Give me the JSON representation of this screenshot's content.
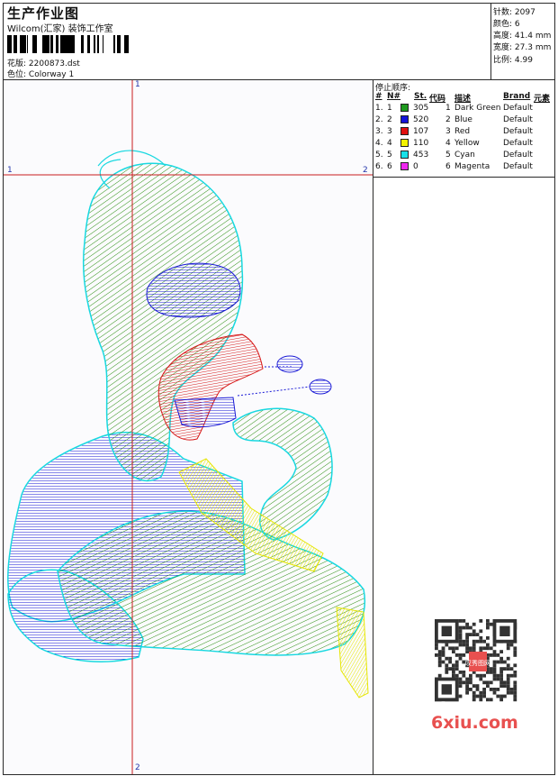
{
  "header": {
    "title": "生产作业图",
    "company": "Wilcom(汇家) 装饰工作室",
    "design_label": "花版:",
    "design_file": "2200873.dst",
    "colorway_label": "色位:",
    "colorway": "Colorway 1"
  },
  "stats": [
    {
      "label": "针数:",
      "value": "2097"
    },
    {
      "label": "颜色:",
      "value": "6"
    },
    {
      "label": "高度:",
      "value": "41.4 mm"
    },
    {
      "label": "宽度:",
      "value": "27.3 mm"
    },
    {
      "label": "比例:",
      "value": "4.99"
    }
  ],
  "legend": {
    "title": "停止顺序:",
    "headers": {
      "hash": "#",
      "no": "N#",
      "st": "St.",
      "code": "代码",
      "desc": "描述",
      "brand": "Brand",
      "element": "元素"
    },
    "rows": [
      {
        "idx": "1.",
        "no": "1",
        "color": "#1f9a1f",
        "st": "305",
        "code": "1",
        "desc": "Dark Green",
        "brand": "Default"
      },
      {
        "idx": "2.",
        "no": "2",
        "color": "#1414d8",
        "st": "520",
        "code": "2",
        "desc": "Blue",
        "brand": "Default"
      },
      {
        "idx": "3.",
        "no": "3",
        "color": "#e01010",
        "st": "107",
        "code": "3",
        "desc": "Red",
        "brand": "Default"
      },
      {
        "idx": "4.",
        "no": "4",
        "color": "#f4f400",
        "st": "110",
        "code": "4",
        "desc": "Yellow",
        "brand": "Default"
      },
      {
        "idx": "5.",
        "no": "5",
        "color": "#18e0e8",
        "st": "453",
        "code": "5",
        "desc": "Cyan",
        "brand": "Default"
      },
      {
        "idx": "6.",
        "no": "6",
        "color": "#f028f0",
        "st": "0",
        "code": "6",
        "desc": "Magenta",
        "brand": "Default"
      }
    ]
  },
  "axes": {
    "v_top": "1",
    "v_bottom": "2",
    "h_left": "1",
    "h_right": "2",
    "color": "#c81e1e"
  },
  "watermark": "6xiu.com",
  "qr_stamp": "叹秀图网"
}
